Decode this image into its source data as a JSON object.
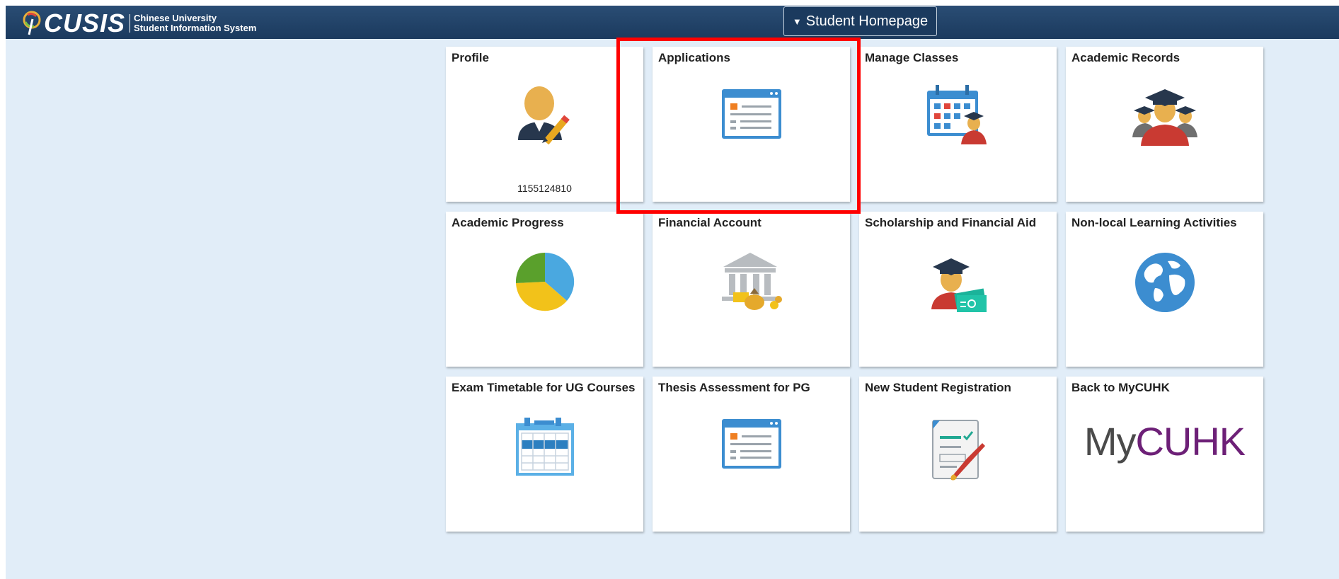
{
  "header": {
    "logo_text": "CUSIS",
    "logo_subtitle_line1": "Chinese University",
    "logo_subtitle_line2": "Student Information System",
    "homepage_selector": "Student Homepage"
  },
  "tiles": [
    {
      "title": "Profile",
      "icon": "student-profile-icon",
      "footer": "1155124810"
    },
    {
      "title": "Applications",
      "icon": "application-form-icon"
    },
    {
      "title": "Manage Classes",
      "icon": "class-calendar-icon"
    },
    {
      "title": "Academic Records",
      "icon": "graduates-icon"
    },
    {
      "title": "Academic Progress",
      "icon": "pie-chart-icon"
    },
    {
      "title": "Financial Account",
      "icon": "bank-money-icon"
    },
    {
      "title": "Scholarship and Financial Aid",
      "icon": "graduate-cash-icon"
    },
    {
      "title": "Non-local Learning Activities",
      "icon": "globe-icon"
    },
    {
      "title": "Exam Timetable for UG Courses",
      "icon": "timetable-icon"
    },
    {
      "title": "Thesis Assessment for PG",
      "icon": "application-form-icon"
    },
    {
      "title": "New Student Registration",
      "icon": "registration-form-icon"
    },
    {
      "title": "Back to MyCUHK",
      "icon": "mycuhk-logo",
      "logo_text_part1": "My",
      "logo_text_part2": "CUHK"
    }
  ],
  "colors": {
    "header": "#1b3a5e",
    "background": "#e1edf8",
    "tile": "#ffffff",
    "highlight": "#ff0000",
    "icon_blue": "#3c8dd0",
    "mycuhk_gray": "#4a4a4a",
    "mycuhk_purple": "#6d2077"
  }
}
